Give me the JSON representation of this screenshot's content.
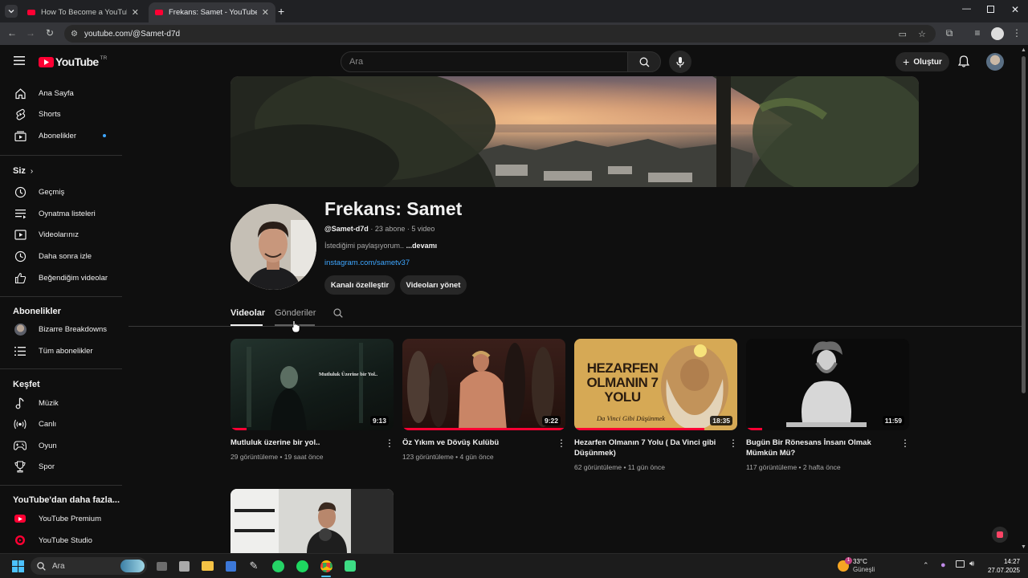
{
  "browser": {
    "tabs": [
      {
        "title": "How To Become a YouTuber (O"
      },
      {
        "title": "Frekans: Samet - YouTube"
      }
    ],
    "url": "youtube.com/@Samet-d7d"
  },
  "masthead": {
    "logo_text": "YouTube",
    "logo_region": "TR",
    "search_placeholder": "Ara",
    "create_label": "Oluştur"
  },
  "sidebar": {
    "main": [
      {
        "label": "Ana Sayfa",
        "icon": "home-icon"
      },
      {
        "label": "Shorts",
        "icon": "shorts-icon"
      },
      {
        "label": "Abonelikler",
        "icon": "subscriptions-icon"
      }
    ],
    "you_header": "Siz",
    "you": [
      {
        "label": "Geçmiş",
        "icon": "history-icon"
      },
      {
        "label": "Oynatma listeleri",
        "icon": "playlists-icon"
      },
      {
        "label": "Videolarınız",
        "icon": "your-videos-icon"
      },
      {
        "label": "Daha sonra izle",
        "icon": "watch-later-icon"
      },
      {
        "label": "Beğendiğim videolar",
        "icon": "liked-icon"
      }
    ],
    "subs_header": "Abonelikler",
    "subs": [
      {
        "label": "Bizarre Breakdowns",
        "icon": "channel-avatar"
      },
      {
        "label": "Tüm abonelikler",
        "icon": "list-icon"
      }
    ],
    "explore_header": "Keşfet",
    "explore": [
      {
        "label": "Müzik",
        "icon": "music-icon"
      },
      {
        "label": "Canlı",
        "icon": "live-icon"
      },
      {
        "label": "Oyun",
        "icon": "gaming-icon"
      },
      {
        "label": "Spor",
        "icon": "trophy-icon"
      }
    ],
    "more_header": "YouTube'dan daha fazla...",
    "more": [
      {
        "label": "YouTube Premium",
        "icon": "premium-icon"
      },
      {
        "label": "YouTube Studio",
        "icon": "studio-icon"
      }
    ]
  },
  "channel": {
    "name": "Frekans: Samet",
    "handle": "@Samet-d7d",
    "subscribers": "23 abone",
    "video_count": "5 video",
    "description": "İstediğimi paylaşıyorum..",
    "more_label": "...devamı",
    "link": "instagram.com/sametv37",
    "customize_label": "Kanalı özelleştir",
    "manage_label": "Videoları yönet",
    "tabs": [
      "Videolar",
      "Gönderiler"
    ]
  },
  "videos": [
    {
      "title": "Mutluluk üzerine bir yol..",
      "views": "29 görüntüleme",
      "age": "19 saat önce",
      "duration": "9:13",
      "thumb_text": "Mutluluk Üzerine bir Yol..",
      "progress": 0.1
    },
    {
      "title": "Öz Yıkım ve Dövüş Kulübü",
      "views": "123 görüntüleme",
      "age": "4 gün önce",
      "duration": "9:22",
      "thumb_text": "",
      "progress": 1.0
    },
    {
      "title": "Hezarfen Olmanın 7 Yolu ( Da Vinci gibi Düşünmek)",
      "views": "62 görüntüleme",
      "age": "11 gün önce",
      "duration": "18:35",
      "thumb_text": "HEZARFEN OLMANIN 7 YOLU",
      "thumb_sub": "Da Vinci Gibi Düşünmek",
      "progress": 0.8
    },
    {
      "title": "Bugün Bir Rönesans İnsanı Olmak Mümkün Mü?",
      "views": "117 görüntüleme",
      "age": "2 hafta önce",
      "duration": "11:59",
      "thumb_text": "",
      "progress": 0.1
    }
  ],
  "taskbar": {
    "search_placeholder": "Ara",
    "weather_temp": "33°C",
    "weather_desc": "Güneşli",
    "weather_badge": "1",
    "time": "14:27",
    "date": "27.07.2025"
  },
  "colors": {
    "accent": "#ff0033",
    "link": "#3ea6ff"
  }
}
